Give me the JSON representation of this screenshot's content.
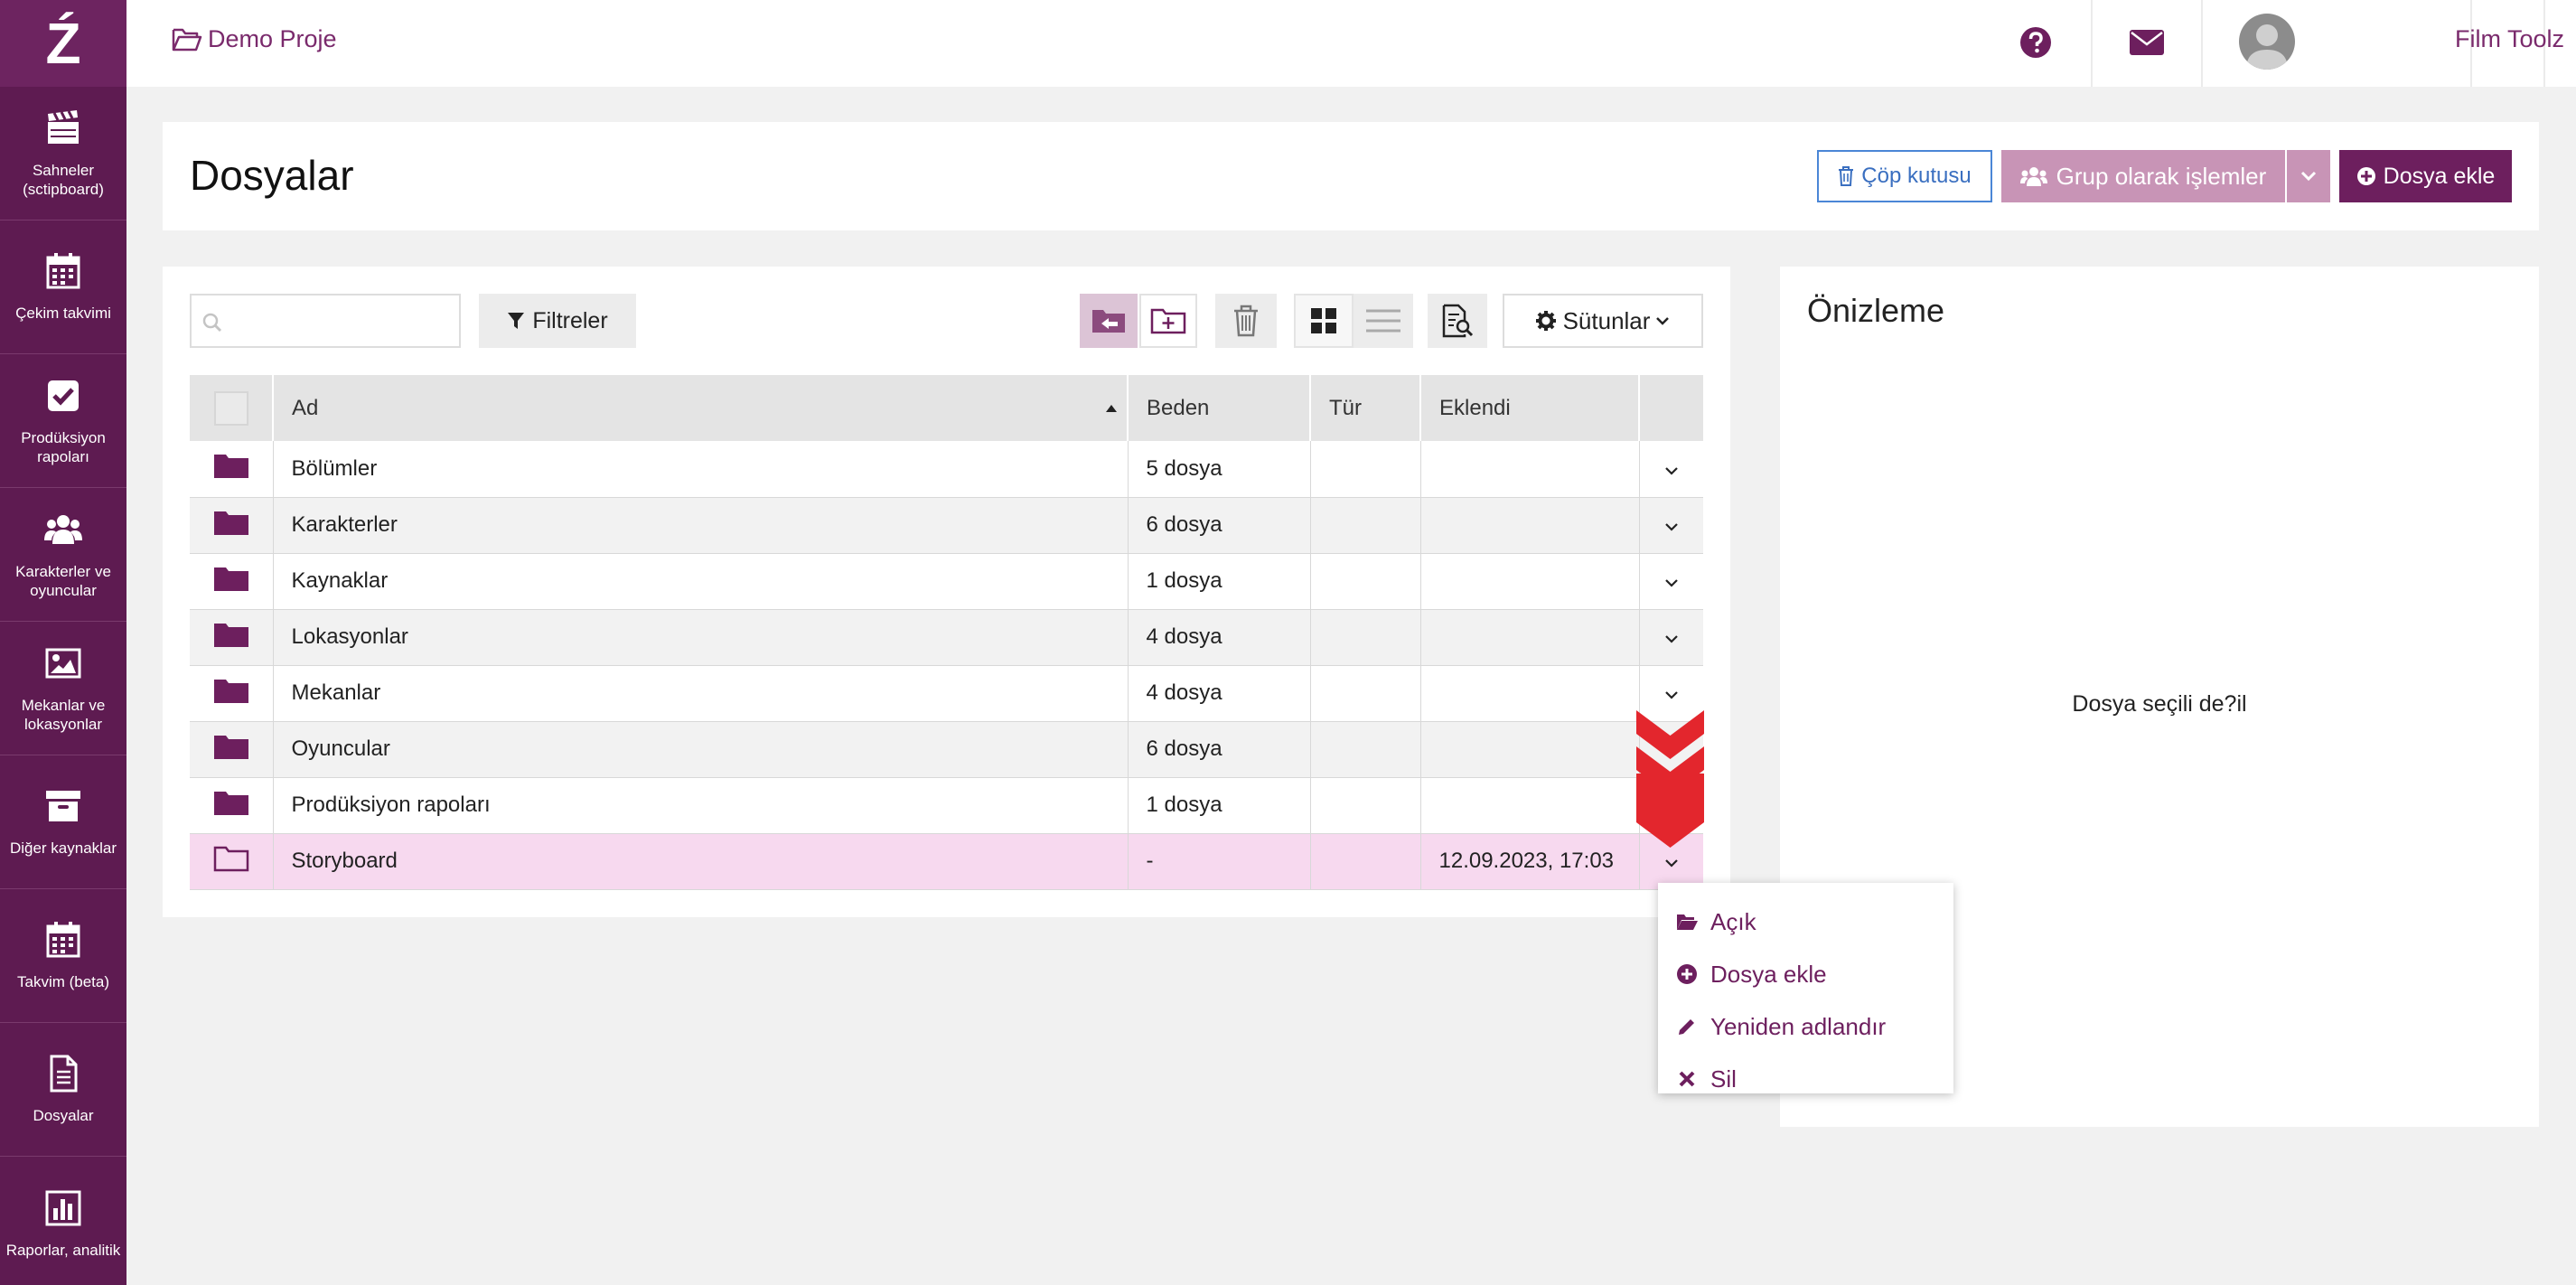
{
  "sidebar": {
    "logo": "Ź",
    "items": [
      {
        "label": "Sahneler (sctipboard)",
        "icon": "clapperboard-icon"
      },
      {
        "label": "Çekim takvimi",
        "icon": "calendar-icon"
      },
      {
        "label": "Prodüksiyon rapoları",
        "icon": "checkbox-icon"
      },
      {
        "label": "Karakterler ve oyuncular",
        "icon": "users-icon"
      },
      {
        "label": "Mekanlar ve lokasyonlar",
        "icon": "image-icon"
      },
      {
        "label": "Diğer kaynaklar",
        "icon": "archive-icon"
      },
      {
        "label": "Takvim (beta)",
        "icon": "calendar-icon"
      },
      {
        "label": "Dosyalar",
        "icon": "document-icon"
      },
      {
        "label": "Raporlar, analitik",
        "icon": "bar-chart-icon"
      }
    ]
  },
  "topbar": {
    "project": "Demo Proje",
    "user": "Film Toolz",
    "lang": "TR"
  },
  "header": {
    "title": "Dosyalar",
    "trash_label": "Çöp kutusu",
    "group_label": "Grup olarak işlemler",
    "add_label": "Dosya ekle"
  },
  "toolbar": {
    "search_placeholder": "",
    "filter_label": "Filtreler",
    "columns_label": "Sütunlar"
  },
  "table": {
    "columns": [
      "Ad",
      "Beden",
      "Tür",
      "Eklendi"
    ],
    "rows": [
      {
        "name": "Bölümler",
        "size": "5 dosya",
        "type": "",
        "added": ""
      },
      {
        "name": "Karakterler",
        "size": "6 dosya",
        "type": "",
        "added": ""
      },
      {
        "name": "Kaynaklar",
        "size": "1 dosya",
        "type": "",
        "added": ""
      },
      {
        "name": "Lokasyonlar",
        "size": "4 dosya",
        "type": "",
        "added": ""
      },
      {
        "name": "Mekanlar",
        "size": "4 dosya",
        "type": "",
        "added": ""
      },
      {
        "name": "Oyuncular",
        "size": "6 dosya",
        "type": "",
        "added": ""
      },
      {
        "name": "Prodüksiyon rapoları",
        "size": "1 dosya",
        "type": "",
        "added": ""
      },
      {
        "name": "Storyboard",
        "size": "-",
        "type": "",
        "added": "12.09.2023, 17:03"
      }
    ]
  },
  "preview": {
    "title": "Önizleme",
    "empty": "Dosya seçili de?il"
  },
  "context_menu": {
    "items": [
      "Açık",
      "Dosya ekle",
      "Yeniden adlandır",
      "Sil"
    ]
  },
  "colors": {
    "brand": "#5e1b51",
    "accent": "#6d1f5e",
    "selected_row": "#f7d9ef",
    "hint": "#e3262d"
  }
}
